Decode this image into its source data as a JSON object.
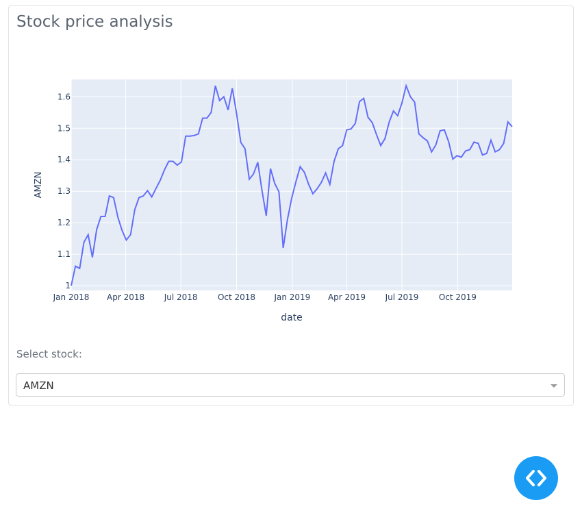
{
  "card": {
    "title": "Stock price analysis"
  },
  "chart_data": {
    "type": "line",
    "title": "",
    "xlabel": "date",
    "ylabel": "AMZN",
    "xlim": [
      "2018-01-01",
      "2019-12-30"
    ],
    "ylim": [
      0.985,
      1.655
    ],
    "x_ticks": [
      {
        "date": "2018-01-01",
        "label": "Jan 2018"
      },
      {
        "date": "2018-04-01",
        "label": "Apr 2018"
      },
      {
        "date": "2018-07-01",
        "label": "Jul 2018"
      },
      {
        "date": "2018-10-01",
        "label": "Oct 2018"
      },
      {
        "date": "2019-01-01",
        "label": "Jan 2019"
      },
      {
        "date": "2019-04-01",
        "label": "Apr 2019"
      },
      {
        "date": "2019-07-01",
        "label": "Jul 2019"
      },
      {
        "date": "2019-10-01",
        "label": "Oct 2019"
      }
    ],
    "y_ticks": [
      1,
      1.1,
      1.2,
      1.3,
      1.4,
      1.5,
      1.6
    ],
    "grid": true,
    "line_color": "#636efa",
    "plot_bg": "#e5ecf6",
    "series": [
      {
        "x": [
          "2018-01-01",
          "2018-01-08",
          "2018-01-15",
          "2018-01-22",
          "2018-01-29",
          "2018-02-05",
          "2018-02-12",
          "2018-02-19",
          "2018-02-26",
          "2018-03-05",
          "2018-03-12",
          "2018-03-19",
          "2018-03-26",
          "2018-04-02",
          "2018-04-09",
          "2018-04-16",
          "2018-04-23",
          "2018-04-30",
          "2018-05-07",
          "2018-05-14",
          "2018-05-21",
          "2018-05-28",
          "2018-06-04",
          "2018-06-11",
          "2018-06-18",
          "2018-06-25",
          "2018-07-02",
          "2018-07-09",
          "2018-07-16",
          "2018-07-23",
          "2018-07-30",
          "2018-08-06",
          "2018-08-13",
          "2018-08-20",
          "2018-08-27",
          "2018-09-03",
          "2018-09-10",
          "2018-09-17",
          "2018-09-24",
          "2018-10-01",
          "2018-10-08",
          "2018-10-15",
          "2018-10-22",
          "2018-10-29",
          "2018-11-05",
          "2018-11-12",
          "2018-11-19",
          "2018-11-26",
          "2018-12-03",
          "2018-12-10",
          "2018-12-17",
          "2018-12-24",
          "2018-12-31",
          "2019-01-07",
          "2019-01-14",
          "2019-01-21",
          "2019-01-28",
          "2019-02-04",
          "2019-02-11",
          "2019-02-18",
          "2019-02-25",
          "2019-03-04",
          "2019-03-11",
          "2019-03-18",
          "2019-03-25",
          "2019-04-01",
          "2019-04-08",
          "2019-04-15",
          "2019-04-22",
          "2019-04-29",
          "2019-05-06",
          "2019-05-13",
          "2019-05-20",
          "2019-05-27",
          "2019-06-03",
          "2019-06-10",
          "2019-06-17",
          "2019-06-24",
          "2019-07-01",
          "2019-07-08",
          "2019-07-15",
          "2019-07-22",
          "2019-07-29",
          "2019-08-05",
          "2019-08-12",
          "2019-08-19",
          "2019-08-26",
          "2019-09-02",
          "2019-09-09",
          "2019-09-16",
          "2019-09-23",
          "2019-09-30",
          "2019-10-07",
          "2019-10-14",
          "2019-10-21",
          "2019-10-28",
          "2019-11-04",
          "2019-11-11",
          "2019-11-18",
          "2019-11-25",
          "2019-12-02",
          "2019-12-09",
          "2019-12-16",
          "2019-12-23",
          "2019-12-30"
        ],
        "values": [
          1.0,
          1.062,
          1.055,
          1.138,
          1.162,
          1.09,
          1.178,
          1.22,
          1.22,
          1.285,
          1.28,
          1.218,
          1.175,
          1.145,
          1.162,
          1.242,
          1.28,
          1.285,
          1.302,
          1.282,
          1.309,
          1.335,
          1.368,
          1.395,
          1.395,
          1.383,
          1.393,
          1.475,
          1.475,
          1.477,
          1.482,
          1.532,
          1.532,
          1.55,
          1.635,
          1.588,
          1.6,
          1.558,
          1.627,
          1.547,
          1.455,
          1.435,
          1.338,
          1.355,
          1.392,
          1.302,
          1.222,
          1.372,
          1.325,
          1.298,
          1.12,
          1.21,
          1.278,
          1.33,
          1.378,
          1.36,
          1.322,
          1.292,
          1.308,
          1.328,
          1.358,
          1.322,
          1.395,
          1.435,
          1.445,
          1.495,
          1.498,
          1.515,
          1.585,
          1.595,
          1.535,
          1.518,
          1.48,
          1.445,
          1.467,
          1.52,
          1.555,
          1.54,
          1.58,
          1.635,
          1.6,
          1.583,
          1.482,
          1.47,
          1.46,
          1.425,
          1.447,
          1.492,
          1.495,
          1.458,
          1.402,
          1.413,
          1.408,
          1.428,
          1.432,
          1.456,
          1.452,
          1.415,
          1.42,
          1.462,
          1.425,
          1.432,
          1.452,
          1.52,
          1.505
        ]
      }
    ]
  },
  "dropdown": {
    "label": "Select stock:",
    "selected": "AMZN"
  },
  "code_button": {
    "icon": "code-icon"
  }
}
